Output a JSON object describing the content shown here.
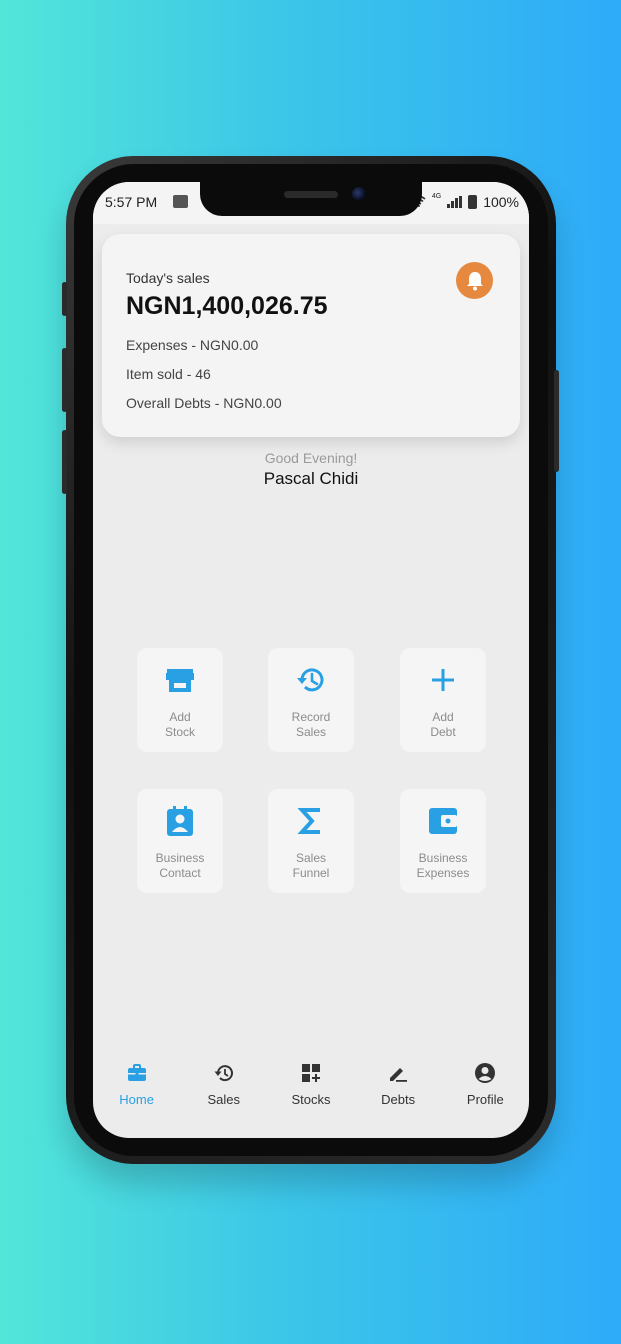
{
  "status": {
    "time": "5:57 PM",
    "network": "4G",
    "battery": "100%"
  },
  "summary": {
    "label": "Today's sales",
    "amount": "NGN1,400,026.75",
    "expenses": "Expenses - NGN0.00",
    "items_sold": "Item sold - 46",
    "debts": "Overall Debts - NGN0.00",
    "bell_color": "#e6893f"
  },
  "greeting": {
    "message": "Good Evening!",
    "name": "Pascal Chidi"
  },
  "actions": [
    {
      "label": "Add\nStock",
      "icon": "store-icon"
    },
    {
      "label": "Record\nSales",
      "icon": "history-icon"
    },
    {
      "label": "Add\nDebt",
      "icon": "plus-icon"
    },
    {
      "label": "Business\nContact",
      "icon": "contact-icon"
    },
    {
      "label": "Sales\nFunnel",
      "icon": "sigma-icon"
    },
    {
      "label": "Business\nExpenses",
      "icon": "wallet-icon"
    }
  ],
  "nav": [
    {
      "label": "Home",
      "icon": "briefcase-icon",
      "active": true
    },
    {
      "label": "Sales",
      "icon": "history-icon"
    },
    {
      "label": "Stocks",
      "icon": "grid-add-icon"
    },
    {
      "label": "Debts",
      "icon": "pen-icon"
    },
    {
      "label": "Profile",
      "icon": "account-icon"
    }
  ],
  "colors": {
    "accent": "#2aa0e4",
    "background": "#ececec",
    "card": "#f4f4f4"
  }
}
